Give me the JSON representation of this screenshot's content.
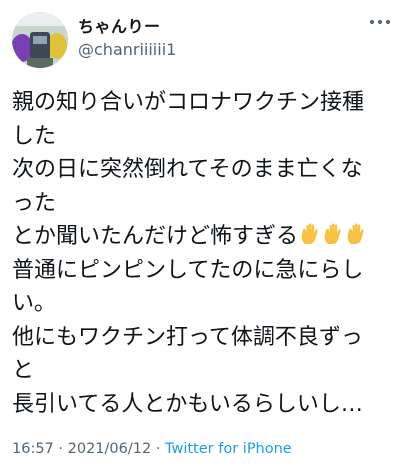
{
  "user": {
    "display_name": "ちゃんりー",
    "handle": "@chanriiiiii1",
    "avatar_icon": "profile-avatar-icon"
  },
  "tweet": {
    "lines": [
      "親の知り合いがコロナワクチン接種",
      "した",
      "次の日に突然倒れてそのまま亡くな",
      "った",
      "とか聞いたんだけど怖すぎる",
      "普通にピンピンしてたのに急にらし",
      "い。",
      "他にもワクチン打って体調不良ずっ",
      "と",
      "長引いてる人とかもいるらしいし…"
    ],
    "emoji": [
      "raised-hand-icon",
      "raised-hand-icon",
      "raised-hand-icon"
    ]
  },
  "meta": {
    "time": "16:57",
    "separator1": " · ",
    "date": "2021/06/12",
    "separator2": " · ",
    "source": "Twitter for iPhone"
  },
  "icons": {
    "more": "more-horizontal-icon"
  },
  "colors": {
    "text": "#0f1419",
    "secondary": "#536471",
    "link": "#1d9bf0"
  }
}
